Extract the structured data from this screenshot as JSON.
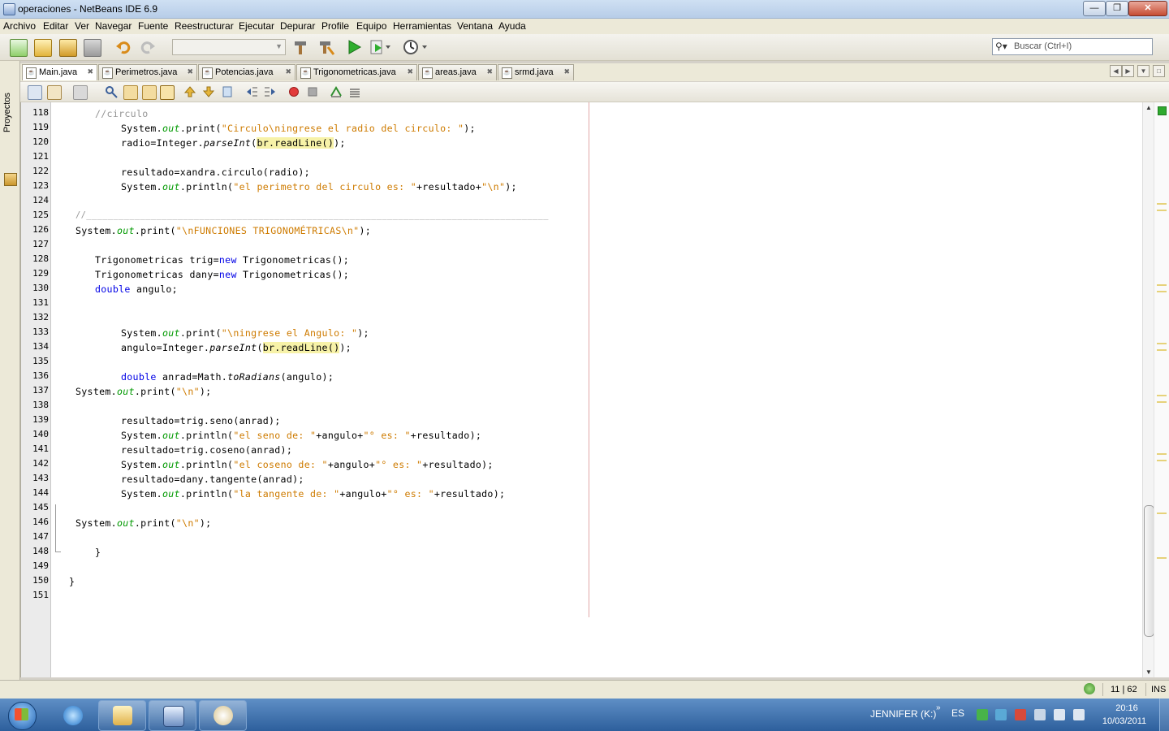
{
  "window": {
    "title": "operaciones - NetBeans IDE 6.9",
    "controls": {
      "minimize": "—",
      "maximize": "❐",
      "close": "✕"
    }
  },
  "menubar": [
    "Archivo",
    "Editar",
    "Ver",
    "Navegar",
    "Fuente",
    "Reestructurar",
    "Ejecutar",
    "Depurar",
    "Profile",
    "Equipo",
    "Herramientas",
    "Ventana",
    "Ayuda"
  ],
  "toolbar": {
    "config_value": "",
    "search_placeholder": "Buscar (Ctrl+I)"
  },
  "side_panel": {
    "label": "Proyectos"
  },
  "tabs": [
    {
      "label": "Main.java",
      "active": true
    },
    {
      "label": "Perimetros.java",
      "active": false
    },
    {
      "label": "Potencias.java",
      "active": false
    },
    {
      "label": "Trigonometricas.java",
      "active": false
    },
    {
      "label": "areas.java",
      "active": false
    },
    {
      "label": "srmd.java",
      "active": false
    }
  ],
  "editor": {
    "line_numbers": [
      "118",
      "119",
      "120",
      "121",
      "122",
      "123",
      "124",
      "125",
      "126",
      "127",
      "128",
      "129",
      "130",
      "131",
      "132",
      "133",
      "134",
      "135",
      "136",
      "137",
      "138",
      "139",
      "140",
      "141",
      "142",
      "143",
      "144",
      "145",
      "146",
      "147",
      "148",
      "149",
      "150",
      "151"
    ],
    "lines": {
      "l118": {
        "c": "//circulo"
      },
      "l119": {
        "a": "System.",
        "f": "out",
        "b": ".print(",
        "s": "\"Circulo\\ningrese el radio del circulo: \"",
        "e": ");"
      },
      "l120": {
        "a": "radio=Integer.",
        "m": "parseInt",
        "b": "(",
        "h": "br.readLine()",
        "e": ");"
      },
      "l122": {
        "a": "resultado=xandra.circulo(radio);"
      },
      "l123": {
        "a": "System.",
        "f": "out",
        "b": ".println(",
        "s": "\"el perimetro del circulo es: \"",
        "c": "+resultado+",
        "s2": "\"\\n\"",
        "e": ");"
      },
      "l125": {
        "c": "//______________________________________________________________________________________"
      },
      "l126": {
        "a": "System.",
        "f": "out",
        "b": ".print(",
        "s": "\"\\nFUNCIONES TRIGONOMÉTRICAS\\n\"",
        "e": ");"
      },
      "l128": {
        "a": "Trigonometricas trig=",
        "k": "new",
        "e": " Trigonometricas();"
      },
      "l129": {
        "a": "Trigonometricas dany=",
        "k": "new",
        "e": " Trigonometricas();"
      },
      "l130": {
        "k": "double",
        "e": " angulo;"
      },
      "l133": {
        "a": "System.",
        "f": "out",
        "b": ".print(",
        "s": "\"\\ningrese el Angulo: \"",
        "e": ");"
      },
      "l134": {
        "a": "angulo=Integer.",
        "m": "parseInt",
        "b": "(",
        "h": "br.readLine()",
        "e": ");"
      },
      "l136": {
        "k": "double",
        "a": " anrad=Math.",
        "m": "toRadians",
        "e": "(angulo);"
      },
      "l137": {
        "a": "System.",
        "f": "out",
        "b": ".print(",
        "s": "\"\\n\"",
        "e": ");"
      },
      "l139": {
        "a": "resultado=trig.seno(anrad);"
      },
      "l140": {
        "a": "System.",
        "f": "out",
        "b": ".println(",
        "s": "\"el seno de: \"",
        "c": "+angulo+",
        "s2": "\"° es: \"",
        "e": "+resultado);"
      },
      "l141": {
        "a": "resultado=trig.coseno(anrad);"
      },
      "l142": {
        "a": "System.",
        "f": "out",
        "b": ".println(",
        "s": "\"el coseno de: \"",
        "c": "+angulo+",
        "s2": "\"° es: \"",
        "e": "+resultado);"
      },
      "l143": {
        "a": "resultado=dany.tangente(anrad);"
      },
      "l144": {
        "a": "System.",
        "f": "out",
        "b": ".println(",
        "s": "\"la tangente de: \"",
        "c": "+angulo+",
        "s2": "\"° es: \"",
        "e": "+resultado);"
      },
      "l146": {
        "a": "System.",
        "f": "out",
        "b": ".print(",
        "s": "\"\\n\"",
        "e": ");"
      },
      "l148": {
        "a": "}"
      },
      "l150": {
        "a": "}"
      }
    },
    "colors": {
      "keyword": "#0000e6",
      "string": "#ce7b00",
      "field": "#009900",
      "comment": "#969696",
      "highlight": "#f7f2a8"
    }
  },
  "statusbar": {
    "position": "11 | 62",
    "mode": "INS"
  },
  "taskbar": {
    "apps": [
      "internet-explorer",
      "windows-explorer",
      "netbeans",
      "paint"
    ],
    "user": "JENNIFER (K:)",
    "overflow": "»",
    "lang": "ES",
    "time": "20:16",
    "date": "10/03/2011"
  }
}
